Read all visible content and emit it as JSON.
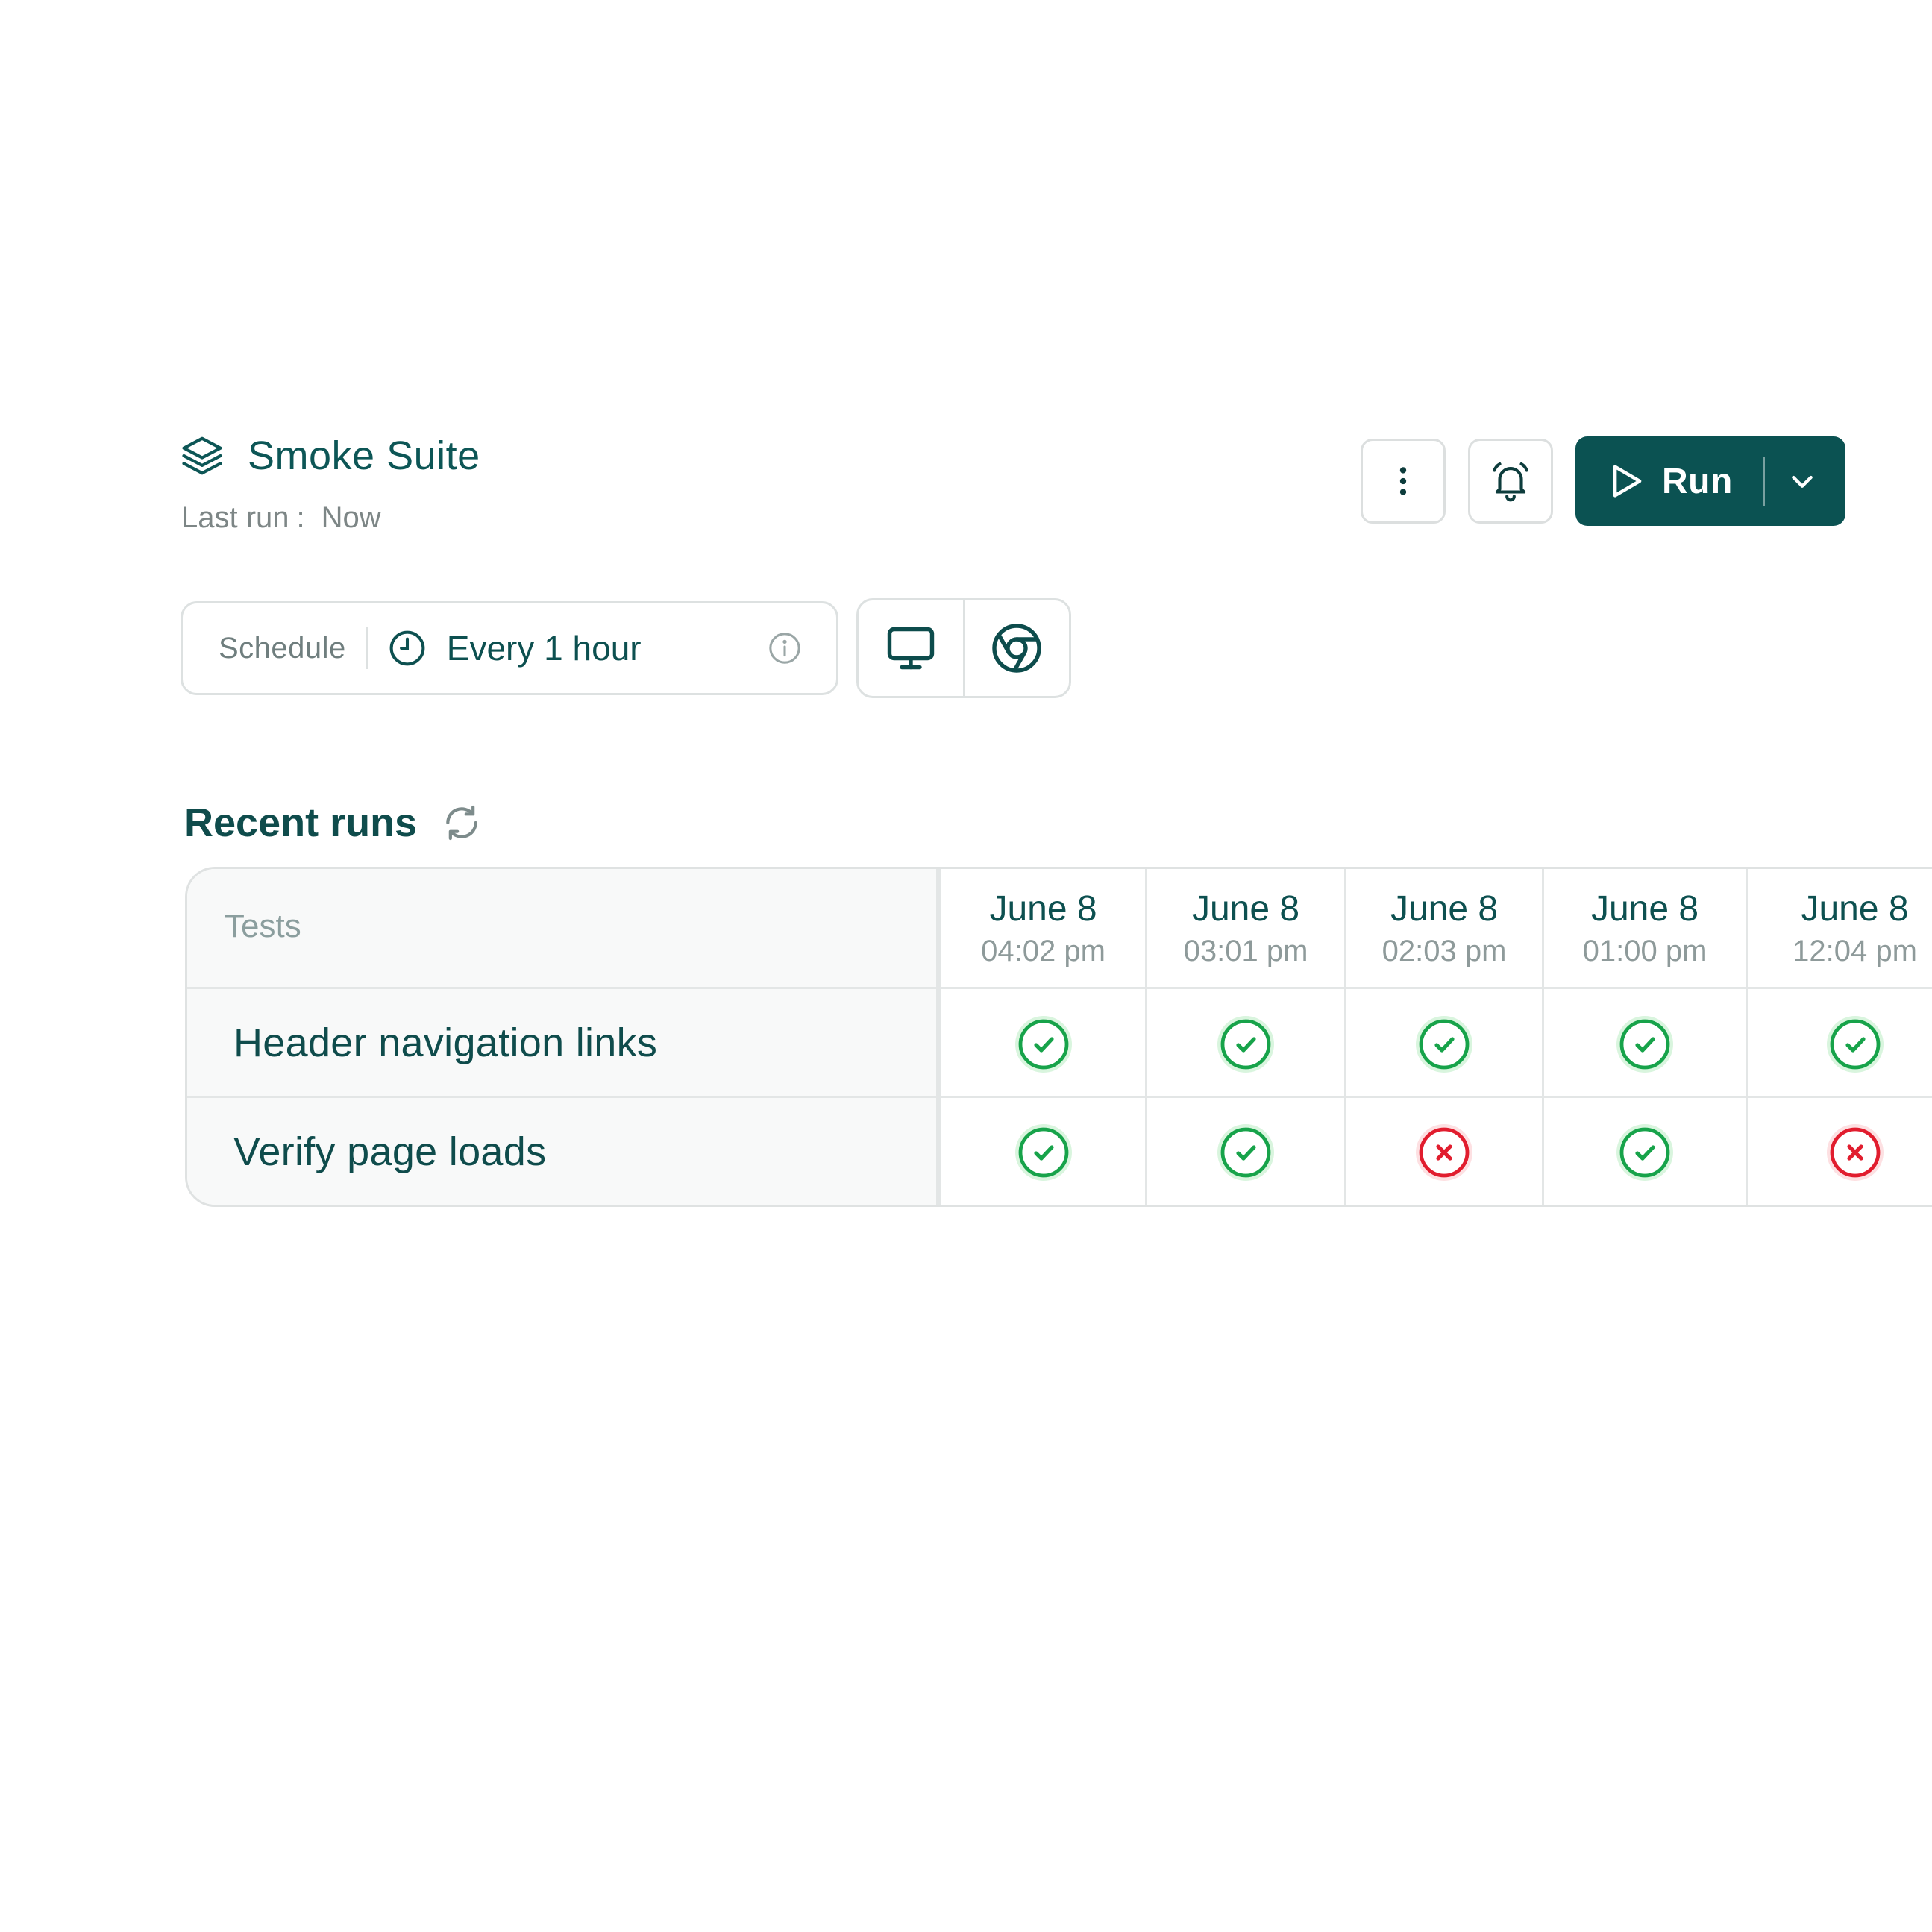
{
  "header": {
    "suite_icon": "layers-icon",
    "title": "Smoke Suite",
    "last_run_label": "Last run",
    "last_run_sep": ":",
    "last_run_value": "Now"
  },
  "actions": {
    "more_icon": "more-vertical-icon",
    "alert_icon": "bell-ring-icon",
    "run_label": "Run",
    "run_icon": "play-icon",
    "dropdown_icon": "chevron-down-icon"
  },
  "schedule": {
    "label": "Schedule",
    "value": "Every 1 hour",
    "clock_icon": "clock-icon",
    "info_icon": "info-icon"
  },
  "devices": {
    "desktop_icon": "monitor-icon",
    "browser_icon": "chrome-icon"
  },
  "recent_runs": {
    "title": "Recent runs",
    "refresh_icon": "refresh-icon",
    "tests_header": "Tests",
    "runs": [
      {
        "date": "June 8",
        "time": "04:02 pm"
      },
      {
        "date": "June 8",
        "time": "03:01 pm"
      },
      {
        "date": "June 8",
        "time": "02:03 pm"
      },
      {
        "date": "June 8",
        "time": "01:00 pm"
      },
      {
        "date": "June 8",
        "time": "12:04 pm"
      }
    ],
    "tests": [
      {
        "name": "Header navigation links",
        "results": [
          "pass",
          "pass",
          "pass",
          "pass",
          "pass"
        ]
      },
      {
        "name": "Verify page loads",
        "results": [
          "pass",
          "pass",
          "fail",
          "pass",
          "fail"
        ]
      }
    ]
  },
  "colors": {
    "brand": "#0b5252",
    "pass": "#17a34a",
    "fail": "#e11d2e"
  }
}
